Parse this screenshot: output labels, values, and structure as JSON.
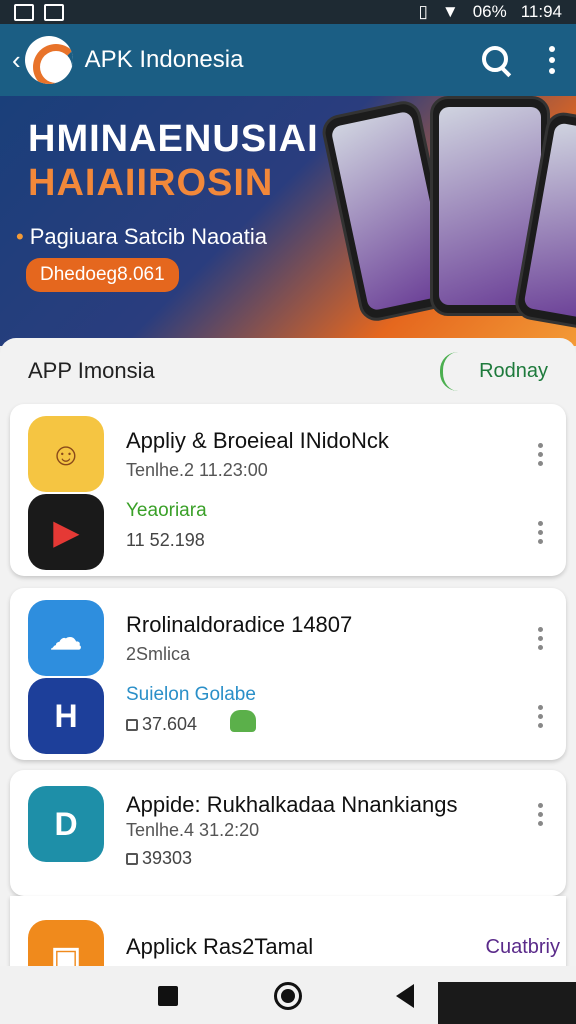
{
  "status_bar": {
    "battery": "06%",
    "time": "11:94"
  },
  "app_bar": {
    "title": "APK Indonesia"
  },
  "banner": {
    "title_line1": "HMINAENUSIAI",
    "title_line2": "HAIAIIROSIN",
    "subtitle": "Pagiuara Satcib Naoatia",
    "badge": "Dhedoeg8.061"
  },
  "section": {
    "title": "APP Imonsia",
    "action": "Rodnay"
  },
  "cards": [
    {
      "rows": [
        {
          "title": "Appliy & Broeieal INidoNck",
          "subtitle": "Tenlhe.2 11.23:00",
          "icon_color": "#f5c542"
        },
        {
          "green_text": "Yeaoriara",
          "meta": "11 52.198",
          "icon_color": "#1a1a1a"
        }
      ]
    },
    {
      "rows": [
        {
          "title": "Rrolinaldoradice 14807",
          "subtitle": "2Smlica",
          "icon_color": "#2e8ede"
        },
        {
          "blue_text": "Suielon Golabe",
          "meta": "37.604",
          "icon_color": "#1d3f9a"
        }
      ]
    },
    {
      "rows": [
        {
          "title": "Appide: Rukhalkadaa Nnankiangs",
          "subtitle": "Tenlhe.4 31.2:20",
          "meta": "39303",
          "icon_color": "#1e8fa8"
        }
      ]
    },
    {
      "rows": [
        {
          "title": "Applick Ras2Tamal",
          "badge": "Cuatbriy",
          "icon_color": "#f08a1c"
        }
      ]
    }
  ]
}
